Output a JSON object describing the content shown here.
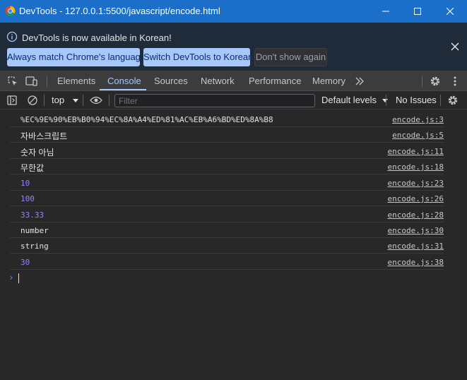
{
  "window": {
    "title": "DevTools - 127.0.0.1:5500/javascript/encode.html"
  },
  "infobar": {
    "message": "DevTools is now available in Korean!",
    "buttons": {
      "match_language": "Always match Chrome's language",
      "switch_korean": "Switch DevTools to Korean",
      "dont_show": "Don't show again"
    }
  },
  "tabs": {
    "elements": "Elements",
    "console": "Console",
    "sources": "Sources",
    "network": "Network",
    "performance": "Performance",
    "memory": "Memory",
    "active": "Console"
  },
  "console_toolbar": {
    "context": "top",
    "filter_placeholder": "Filter",
    "levels": "Default levels",
    "issues": "No Issues"
  },
  "messages": [
    {
      "text": "%EC%9E%90%EB%B0%94%EC%8A%A4%ED%81%AC%EB%A6%BD%ED%8A%B8",
      "kind": "string",
      "source": "encode.js:3"
    },
    {
      "text": "자바스크립트",
      "kind": "string",
      "source": "encode.js:5"
    },
    {
      "text": "숫자 아님",
      "kind": "string",
      "source": "encode.js:11"
    },
    {
      "text": "무한값",
      "kind": "string",
      "source": "encode.js:18"
    },
    {
      "text": "10",
      "kind": "number",
      "source": "encode.js:23"
    },
    {
      "text": "100",
      "kind": "number",
      "source": "encode.js:26"
    },
    {
      "text": "33.33",
      "kind": "number",
      "source": "encode.js:28"
    },
    {
      "text": "number",
      "kind": "string",
      "source": "encode.js:30"
    },
    {
      "text": "string",
      "kind": "string",
      "source": "encode.js:31"
    },
    {
      "text": "30",
      "kind": "number",
      "source": "encode.js:38"
    }
  ],
  "prompt_symbol": "›",
  "colors": {
    "titlebar": "#1b6fc8",
    "accent": "#a8c7fa",
    "number_value": "#9980ff",
    "background": "#282828"
  },
  "icons": {
    "app": "chrome-icon",
    "minimize": "minimize-icon",
    "maximize": "maximize-icon",
    "close": "close-icon",
    "info": "info-icon",
    "inspect": "inspect-element-icon",
    "device": "device-toolbar-icon",
    "more_tabs": "chevron-double-right-icon",
    "settings": "gear-icon",
    "menu": "kebab-menu-icon",
    "sidebar": "sidebar-toggle-icon",
    "clear": "clear-console-icon",
    "eye": "eye-icon"
  }
}
